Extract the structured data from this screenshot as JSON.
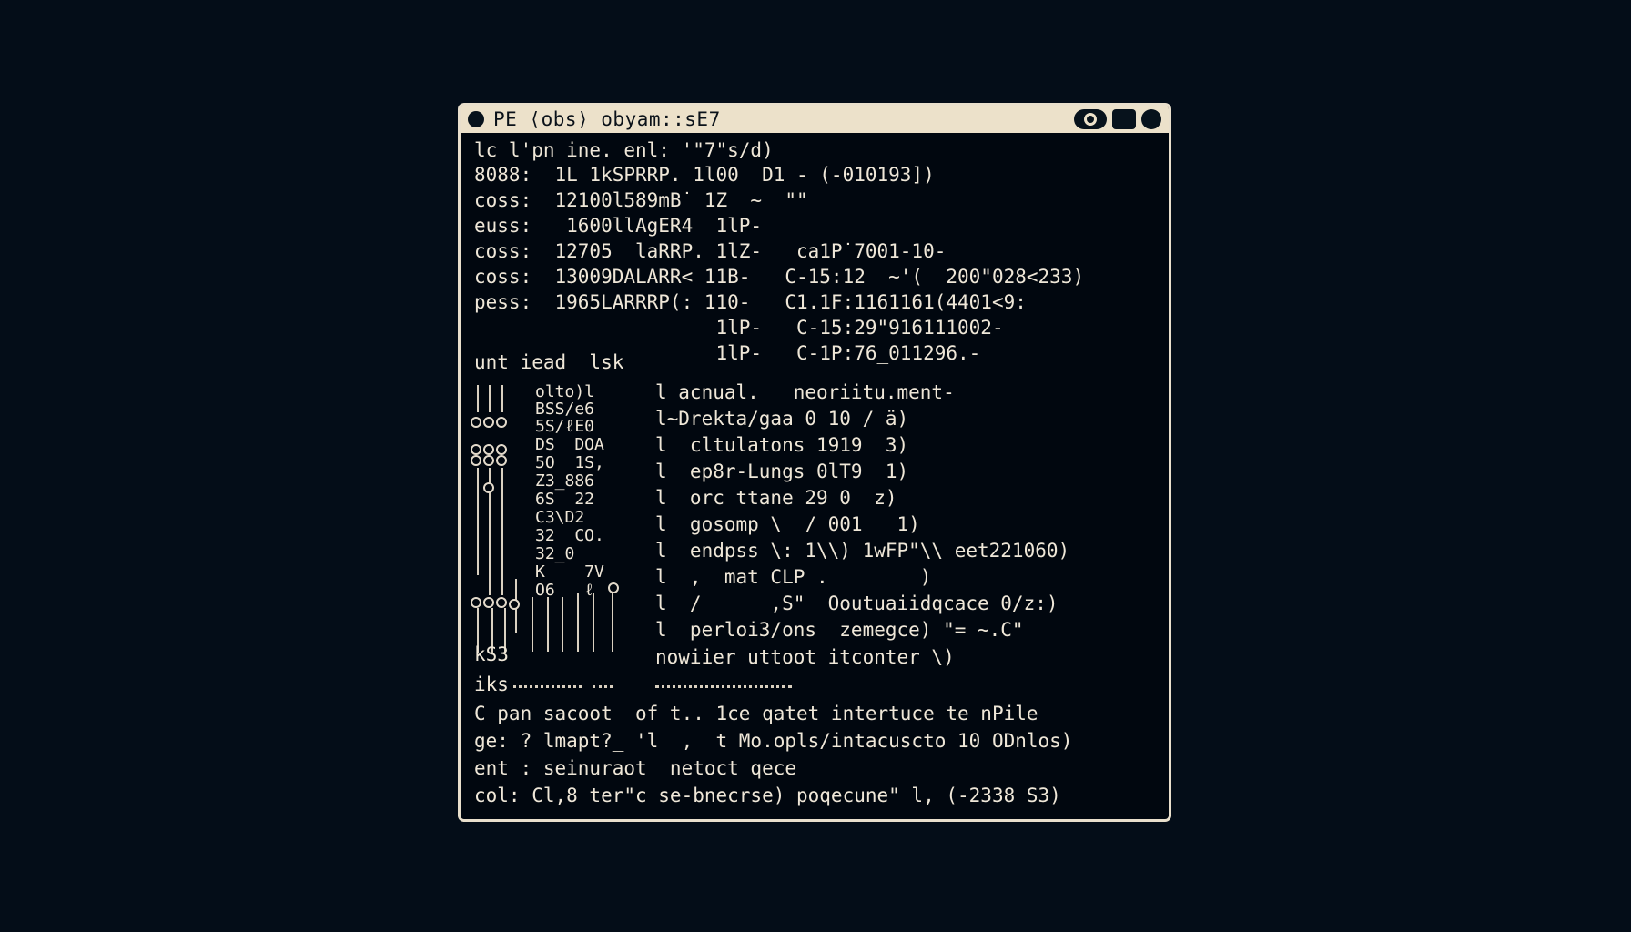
{
  "window": {
    "title": "PE ⟨obs⟩ obyam::sE7"
  },
  "terminal": {
    "header_lines": [
      "lc l'pn ine. enl: '\"7\"s/d)",
      "8088:  1L 1kSPRRP. 1l00  D1 - (-010193])",
      "coss:  12100l589mB˙ 1Z  ~  \"\"",
      "euss:   1600llAgER4  1lP-",
      "coss:  12705  laRRP. 1lZ-   ca1P˙7001-10-",
      "coss:  13009DALARR< 11B-   C-15:12  ~'(  200\"028<233)",
      "pess:  1965LARRRP(: 110-   C1.1F:1161161(4401<9:",
      "                     1lP-   C-15:29\"916111002-",
      "                     1lP-   C-1P:76_011296.-"
    ],
    "section_label": "unt iead  lsk",
    "left_column": [
      "olto)l",
      "BSS/e6",
      "5S/ℓE0",
      "DS  DOA",
      "5O  1S,",
      "Z3_886",
      "6S  22",
      "C3\\D2",
      "32  CO.",
      "32_0",
      "K    7V",
      "O6   ℓ"
    ],
    "right_column": [
      "l acnual.   neoriitu.ment-",
      "l~Drekta/gaa 0 10 / ä)",
      "l  cltulatons 1919  3)",
      "l  ep8r-Lungs 0lT9  1)",
      "l  orc ttane 29 0  z)",
      "l  gosomp \\  / 001   1)",
      "l  endpss \\: 1\\\\) 1wFP\"\\\\ eet221060)",
      "l  ,  mat CLP .        )",
      "l  /      ,S\"  Ooutuaiidqcace 0/z:)",
      "l  perloi3/ons  zemegce) \"= ~.C\"",
      "nowiier uttoot itconter \\)"
    ],
    "ks_label": "kS3",
    "iks_label": "iks",
    "footer_lines": [
      "C pan sacoot  of t.. 1ce qatet intertuce te nPile",
      "ge: ? lmapt?_ 'l  ,  t Mo.opls/intacuscto 10 ODnlos)",
      "ent : seinuraot  netoct qece",
      "col: Cl,8 ter\"c se-bnecrse) poqecune\" l, (-2338 S3)"
    ]
  }
}
